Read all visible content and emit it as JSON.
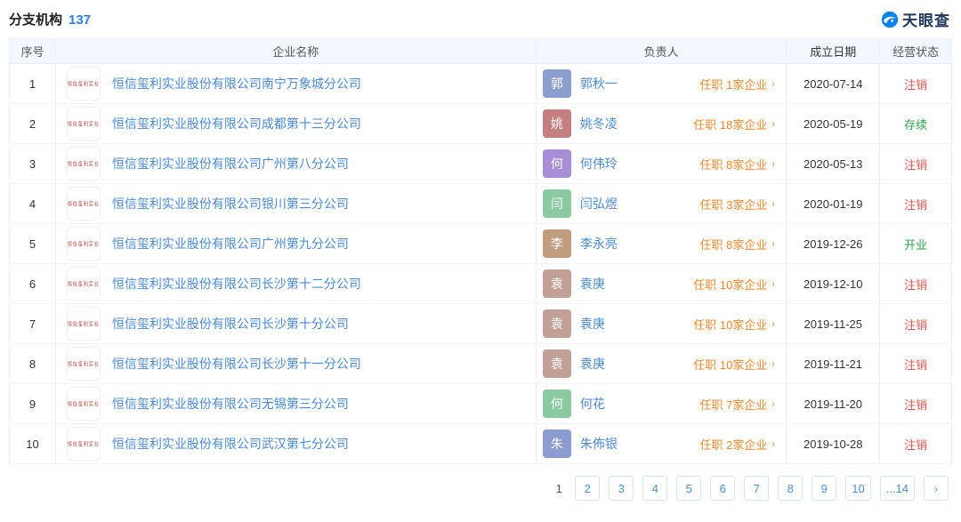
{
  "header": {
    "title": "分支机构",
    "count": "137",
    "brand": "天眼查"
  },
  "colors": {
    "accent_blue": "#2f7de0",
    "link_blue": "#4a8ad4",
    "orange": "#f0882d",
    "status_red": "#e2564f",
    "status_green": "#2ca548",
    "brand_blue": "#0b82f0"
  },
  "icons": {
    "chevron_right": "›",
    "next_page": "›",
    "brand_eye": "eye-swoosh"
  },
  "table": {
    "headers": [
      "序号",
      "企业名称",
      "负责人",
      "成立日期",
      "经营状态"
    ],
    "company_logo_text": "恒信玺利实业",
    "rows": [
      {
        "index": "1",
        "company": "恒信玺利实业股份有限公司南宁万象城分公司",
        "avatar_char": "郭",
        "avatar_color": "#8b9fce",
        "leader": "郭秋一",
        "positions": "任职 1家企业",
        "date": "2020-07-14",
        "status": "注销",
        "status_color": "#e2564f"
      },
      {
        "index": "2",
        "company": "恒信玺利实业股份有限公司成都第十三分公司",
        "avatar_char": "姚",
        "avatar_color": "#c57f7f",
        "leader": "姚冬凌",
        "positions": "任职 18家企业",
        "date": "2020-05-19",
        "status": "存续",
        "status_color": "#2ca548"
      },
      {
        "index": "3",
        "company": "恒信玺利实业股份有限公司广州第八分公司",
        "avatar_char": "何",
        "avatar_color": "#a78fd6",
        "leader": "何伟玲",
        "positions": "任职 8家企业",
        "date": "2020-05-13",
        "status": "注销",
        "status_color": "#e2564f"
      },
      {
        "index": "4",
        "company": "恒信玺利实业股份有限公司银川第三分公司",
        "avatar_char": "闫",
        "avatar_color": "#8bc9a0",
        "leader": "闫弘煜",
        "positions": "任职 3家企业",
        "date": "2020-01-19",
        "status": "注销",
        "status_color": "#e2564f"
      },
      {
        "index": "5",
        "company": "恒信玺利实业股份有限公司广州第九分公司",
        "avatar_char": "李",
        "avatar_color": "#c09d7f",
        "leader": "李永亮",
        "positions": "任职 8家企业",
        "date": "2019-12-26",
        "status": "开业",
        "status_color": "#2ca548"
      },
      {
        "index": "6",
        "company": "恒信玺利实业股份有限公司长沙第十二分公司",
        "avatar_char": "袁",
        "avatar_color": "#c2a096",
        "leader": "袁庚",
        "positions": "任职 10家企业",
        "date": "2019-12-10",
        "status": "注销",
        "status_color": "#e2564f"
      },
      {
        "index": "7",
        "company": "恒信玺利实业股份有限公司长沙第十分公司",
        "avatar_char": "袁",
        "avatar_color": "#c2a096",
        "leader": "袁庚",
        "positions": "任职 10家企业",
        "date": "2019-11-25",
        "status": "注销",
        "status_color": "#e2564f"
      },
      {
        "index": "8",
        "company": "恒信玺利实业股份有限公司长沙第十一分公司",
        "avatar_char": "袁",
        "avatar_color": "#c2a096",
        "leader": "袁庚",
        "positions": "任职 10家企业",
        "date": "2019-11-21",
        "status": "注销",
        "status_color": "#e2564f"
      },
      {
        "index": "9",
        "company": "恒信玺利实业股份有限公司无锡第三分公司",
        "avatar_char": "何",
        "avatar_color": "#8bc9a0",
        "leader": "何花",
        "positions": "任职 7家企业",
        "date": "2019-11-20",
        "status": "注销",
        "status_color": "#e2564f"
      },
      {
        "index": "10",
        "company": "恒信玺利实业股份有限公司武汉第七分公司",
        "avatar_char": "朱",
        "avatar_color": "#8b9cce",
        "leader": "朱佈银",
        "positions": "任职 2家企业",
        "date": "2019-10-28",
        "status": "注销",
        "status_color": "#e2564f"
      }
    ]
  },
  "pagination": {
    "current": "1",
    "pages": [
      "2",
      "3",
      "4",
      "5",
      "6",
      "7",
      "8",
      "9",
      "10",
      "...14"
    ]
  }
}
